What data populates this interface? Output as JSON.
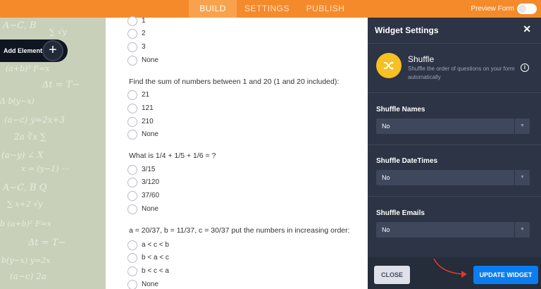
{
  "topbar": {
    "tabs": [
      {
        "label": "BUILD",
        "active": true
      },
      {
        "label": "SETTINGS",
        "active": false
      },
      {
        "label": "PUBLISH",
        "active": false
      }
    ],
    "preview_label": "Preview Form",
    "accent_color": "#f58a2a"
  },
  "left": {
    "add_element_label": "Add Element",
    "add_icon": "plus-icon"
  },
  "form": {
    "questions": [
      {
        "title": "",
        "options": [
          "1",
          "2",
          "3",
          "None"
        ]
      },
      {
        "title": "Find the sum of numbers between 1 and 20 (1 and 20 included):",
        "options": [
          "21",
          "121",
          "210",
          "None"
        ]
      },
      {
        "title": "What is 1/4 + 1/5 + 1/6 = ?",
        "options": [
          "3/15",
          "3/120",
          "37/60",
          "None"
        ]
      },
      {
        "title": "a = 20/37, b = 11/37,  c = 30/37 put the numbers in increasing order:",
        "options": [
          "a < c < b",
          "b < a < c",
          "b < c < a",
          "None"
        ]
      }
    ]
  },
  "panel": {
    "title": "Widget Settings",
    "close_icon": "close-icon",
    "widget": {
      "name": "Shuffle",
      "description": "Shuffle the order of questions on your form automatically",
      "icon": "shuffle-icon",
      "icon_color": "#f7c023"
    },
    "fields": [
      {
        "label": "Shuffle Names",
        "value": "No"
      },
      {
        "label": "Shuffle DateTimes",
        "value": "No"
      },
      {
        "label": "Shuffle Emails",
        "value": "No"
      }
    ],
    "close_button": "CLOSE",
    "update_button": "UPDATE WIDGET",
    "update_color": "#0a7df0"
  }
}
